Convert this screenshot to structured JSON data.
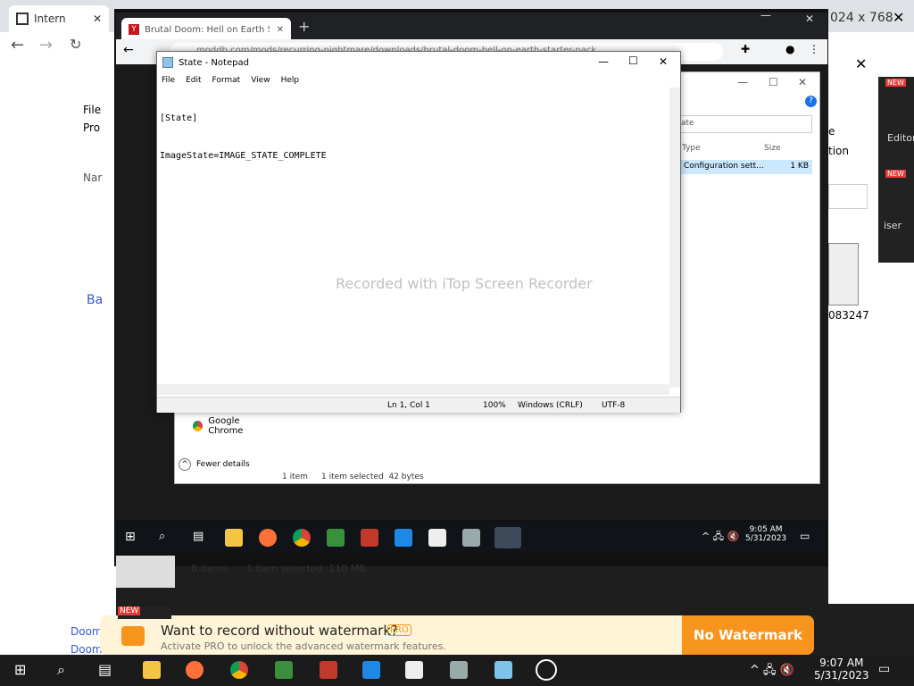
{
  "host_browser": {
    "tab1_title": "Intern",
    "resolution_text": "024 x 768",
    "sidebar_item": "File",
    "sidebar_item2": "Pro",
    "sidebar_item3": "Nar",
    "sidebar_item4": "Ba",
    "doom_link_1": "Doom",
    "doom_link_2": "Doom"
  },
  "vm_browser": {
    "tab_title": "Brutal Doom: Hell on Earth Starte",
    "url": "moddb.com/mods/recurring-nightmare/downloads/brutal-doom-hell-on-earth-starter-pack"
  },
  "notepad": {
    "title": "State - Notepad",
    "menu": [
      "File",
      "Edit",
      "Format",
      "View",
      "Help"
    ],
    "content_line1": "[State]",
    "content_line2": "ImageState=IMAGE_STATE_COMPLETE",
    "status_position": "Ln 1, Col 1",
    "status_zoom": "100%",
    "status_eol": "Windows (CRLF)",
    "status_encoding": "UTF-8"
  },
  "explorer": {
    "search_text": "ate",
    "col_type": "Type",
    "col_size": "Size",
    "row_type": "Configuration sett...",
    "row_size": "1 KB",
    "app_item": "Google Chrome",
    "fewer_details": "Fewer details",
    "status_count": "1 item",
    "status_selected": "1 item selected  42 bytes"
  },
  "watermark_overlay": "Recorded with iTop Screen Recorder",
  "vm_taskbar": {
    "time": "9:05 AM",
    "date": "5/31/2023"
  },
  "host_right_panel": {
    "item1": "Editor",
    "item2": "iser",
    "badge": "NEW",
    "partial_text1": "e",
    "partial_text2": "tion",
    "file_number": "083247"
  },
  "host_explorer_status": {
    "items": "8 items",
    "selected": "1 item selected  110 MB"
  },
  "banner": {
    "badge": "NEW",
    "title": "Want to record without watermark?",
    "pro_label": "PRO",
    "subtitle": "Activate PRO to unlock the advanced watermark features.",
    "button": "No Watermark"
  },
  "host_taskbar": {
    "time": "9:07 AM",
    "date": "5/31/2023"
  },
  "colors": {
    "banner_button": "#f7941d",
    "vm_taskbar": "#101418",
    "host_taskbar": "#1b1b1b"
  }
}
